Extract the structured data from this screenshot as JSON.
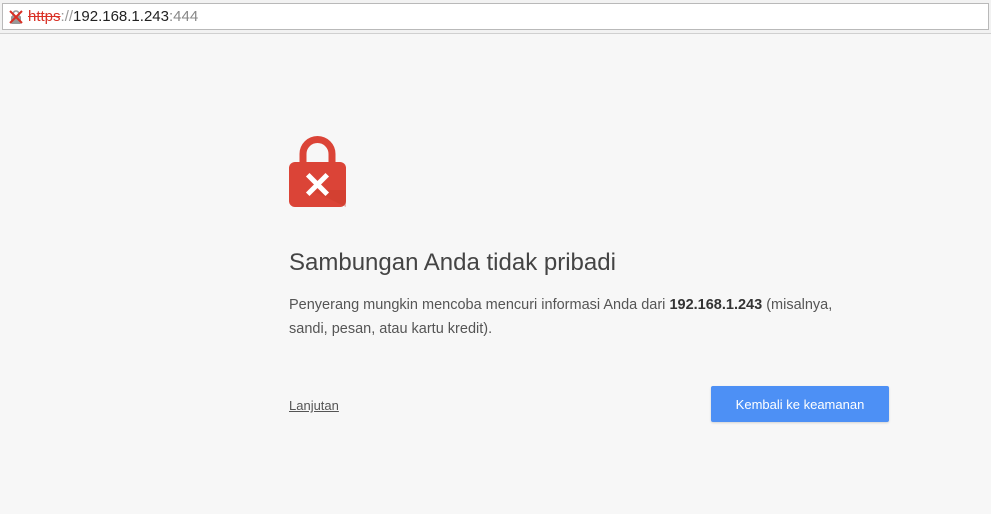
{
  "address_bar": {
    "scheme": "https",
    "separator": "://",
    "host": "192.168.1.243",
    "port": ":444",
    "security_icon": "insecure-lock-icon"
  },
  "interstitial": {
    "icon": "red-lock-x-icon",
    "title": "Sambungan Anda tidak pribadi",
    "description_before": "Penyerang mungkin mencoba mencuri informasi Anda dari ",
    "description_host": "192.168.1.243",
    "description_after": " (misalnya, sandi, pesan, atau kartu kredit).",
    "advanced_link": "Lanjutan",
    "back_button": "Kembali ke keamanan"
  },
  "colors": {
    "accent_button": "#4d90f5",
    "lock_red": "#db4437",
    "background": "#f7f7f7"
  }
}
